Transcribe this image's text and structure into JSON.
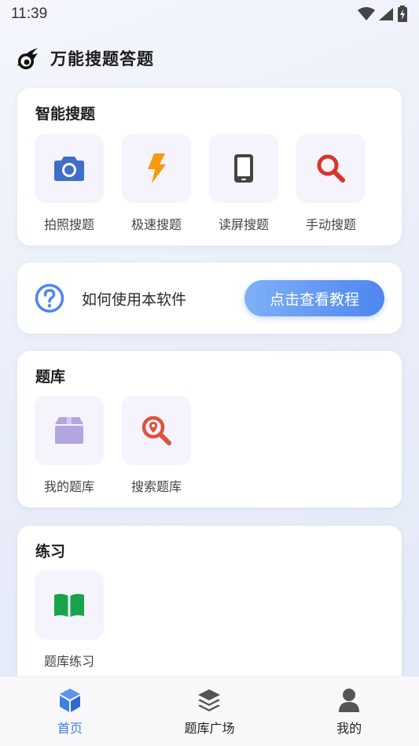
{
  "status_bar": {
    "time": "11:39",
    "icons": [
      "wifi-icon",
      "signal-icon",
      "battery-charging-icon"
    ]
  },
  "header": {
    "title": "万能搜题答题",
    "logo": "meteor-logo"
  },
  "smart_search": {
    "title": "智能搜题",
    "items": [
      {
        "label": "拍照搜题",
        "icon": "camera-icon",
        "color": "#3d6ec9"
      },
      {
        "label": "极速搜题",
        "icon": "lightning-icon",
        "color": "#f59a0f"
      },
      {
        "label": "读屏搜题",
        "icon": "phone-icon",
        "color": "#444444"
      },
      {
        "label": "手动搜题",
        "icon": "search-icon",
        "color": "#d9352b"
      }
    ]
  },
  "help": {
    "text": "如何使用本软件",
    "button": "点击查看教程",
    "icon": "question-circle-icon",
    "accent": "#4d86f0"
  },
  "question_bank": {
    "title": "题库",
    "items": [
      {
        "label": "我的题库",
        "icon": "box-icon",
        "color": "#b3a6e0"
      },
      {
        "label": "搜索题库",
        "icon": "search-location-icon",
        "color": "#e0533d"
      }
    ]
  },
  "practice": {
    "title": "练习",
    "items": [
      {
        "label": "题库练习",
        "icon": "book-icon",
        "color": "#1aa34a"
      }
    ]
  },
  "tabs": [
    {
      "label": "首页",
      "icon": "cube-icon",
      "active": true
    },
    {
      "label": "题库广场",
      "icon": "layers-icon",
      "active": false
    },
    {
      "label": "我的",
      "icon": "user-icon",
      "active": false
    }
  ]
}
